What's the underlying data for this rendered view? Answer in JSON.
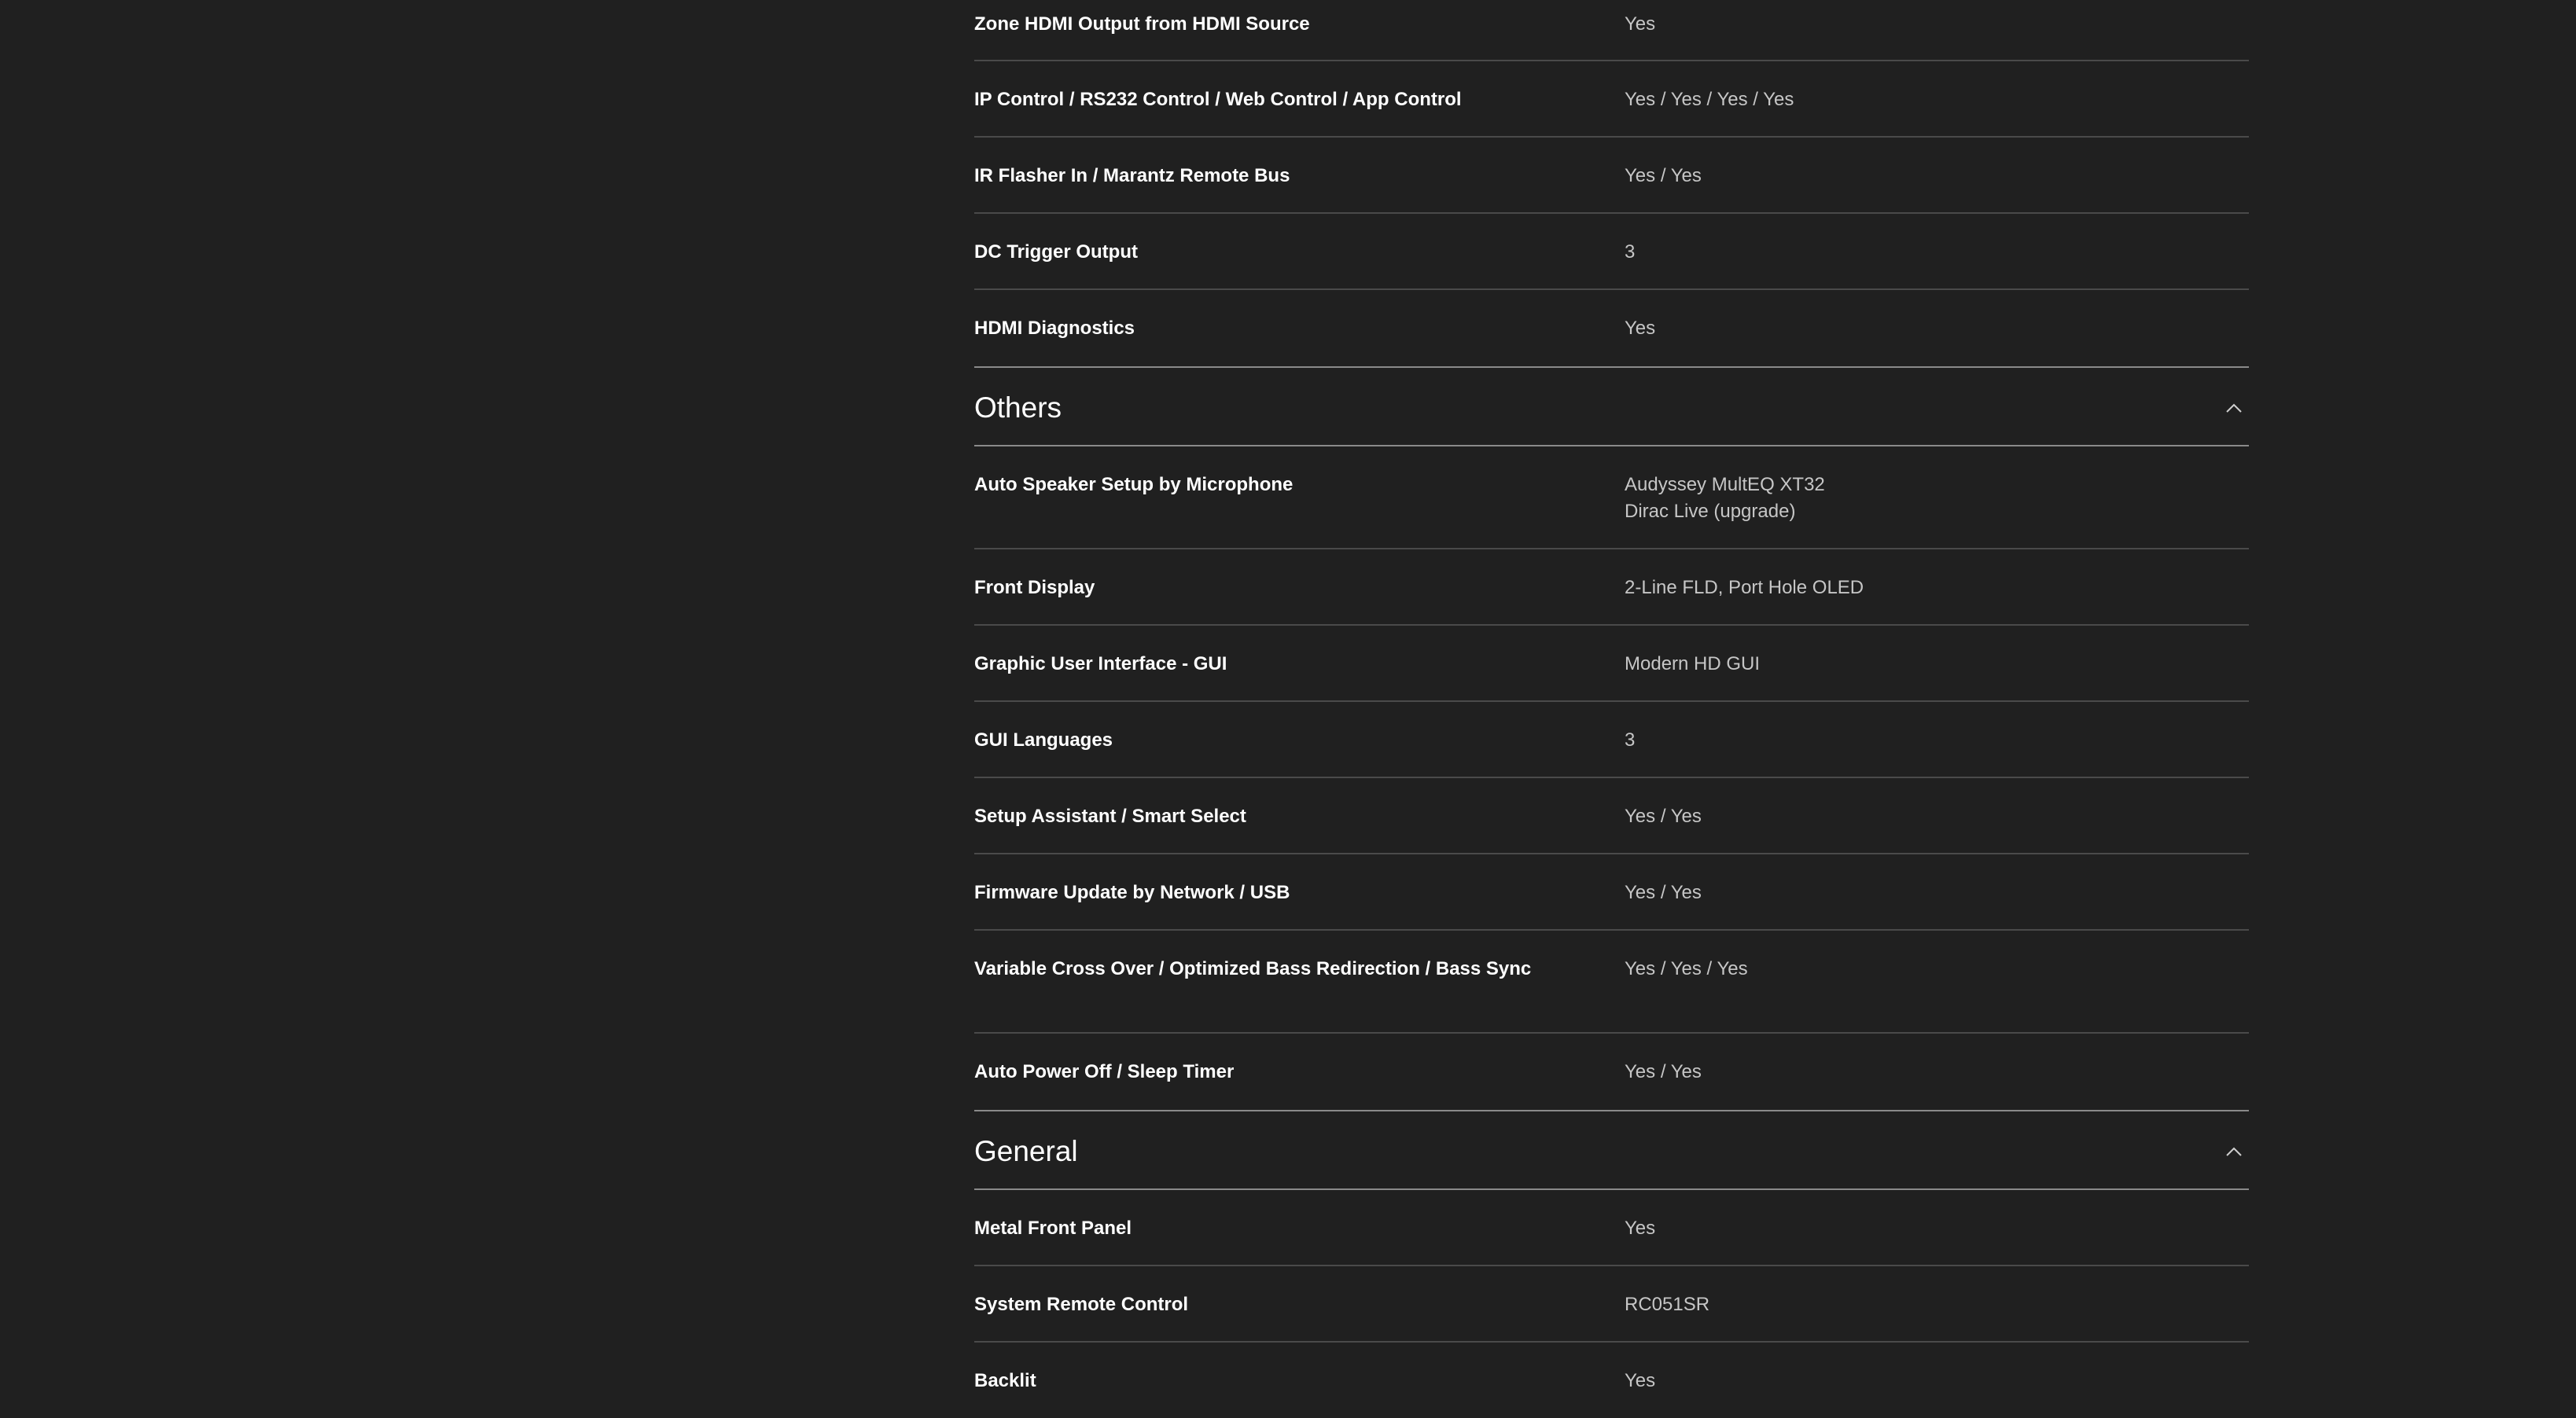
{
  "rows_top": [
    {
      "label": "Zone HDMI Output from HDMI Source",
      "value": "Yes"
    },
    {
      "label": "IP Control / RS232 Control / Web Control / App Control",
      "value": "Yes / Yes / Yes / Yes"
    },
    {
      "label": "IR Flasher In / Marantz Remote Bus",
      "value": "Yes / Yes"
    },
    {
      "label": "DC Trigger Output",
      "value": "3"
    },
    {
      "label": "HDMI Diagnostics",
      "value": "Yes"
    }
  ],
  "others": {
    "title": "Others",
    "toggle_icon": "chevron-up-icon",
    "rows": [
      {
        "label": "Auto Speaker Setup by Microphone",
        "value_lines": [
          "Audyssey MultEQ XT32",
          "Dirac Live (upgrade)"
        ]
      },
      {
        "label": "Front Display",
        "value": "2-Line FLD, Port Hole OLED"
      },
      {
        "label": "Graphic User Interface - GUI",
        "value": "Modern HD GUI"
      },
      {
        "label": "GUI Languages",
        "value": "3"
      },
      {
        "label": "Setup Assistant / Smart Select",
        "value": "Yes / Yes"
      },
      {
        "label": "Firmware Update by Network / USB",
        "value": "Yes / Yes"
      },
      {
        "label": "Variable Cross Over / Optimized Bass Redirection / Bass Sync",
        "value": "Yes / Yes / Yes"
      },
      {
        "label": "Auto Power Off / Sleep Timer",
        "value": "Yes / Yes"
      }
    ]
  },
  "general": {
    "title": "General",
    "toggle_icon": "chevron-up-icon",
    "rows": [
      {
        "label": "Metal Front Panel",
        "value": "Yes"
      },
      {
        "label": "System Remote Control",
        "value": "RC051SR"
      },
      {
        "label": "Backlit",
        "value": "Yes"
      }
    ]
  },
  "colors": {
    "background": "#202020",
    "label_text": "#ffffff",
    "value_text": "#c6c6c6",
    "row_divider": "#4a4a4a",
    "section_divider": "#8a8a8a"
  }
}
